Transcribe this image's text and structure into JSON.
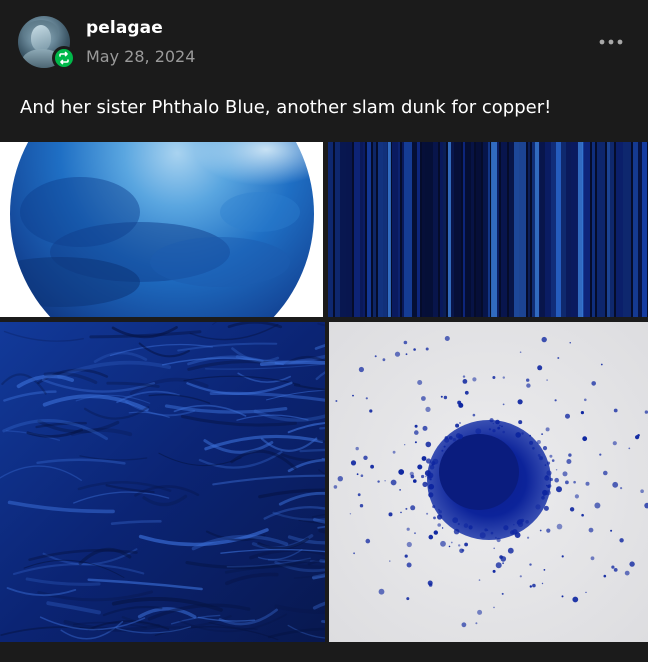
{
  "post": {
    "author": "pelagae",
    "date": "May 28, 2024",
    "caption": "And her sister Phthalo Blue, another slam dunk for copper!",
    "icons": {
      "avatar": "statue-avatar",
      "badge": "reblog-icon",
      "menu": "more-options-icon"
    },
    "colors": {
      "background": "#1b1b1b",
      "badge": "#00b84a",
      "date_text": "#9a9a9a"
    }
  },
  "images": [
    {
      "name": "phthalo-blue-watercolor-circle"
    },
    {
      "name": "phthalo-blue-vertical-streaks"
    },
    {
      "name": "phthalo-blue-brush-strokes"
    },
    {
      "name": "phthalo-blue-pigment-powder"
    }
  ]
}
